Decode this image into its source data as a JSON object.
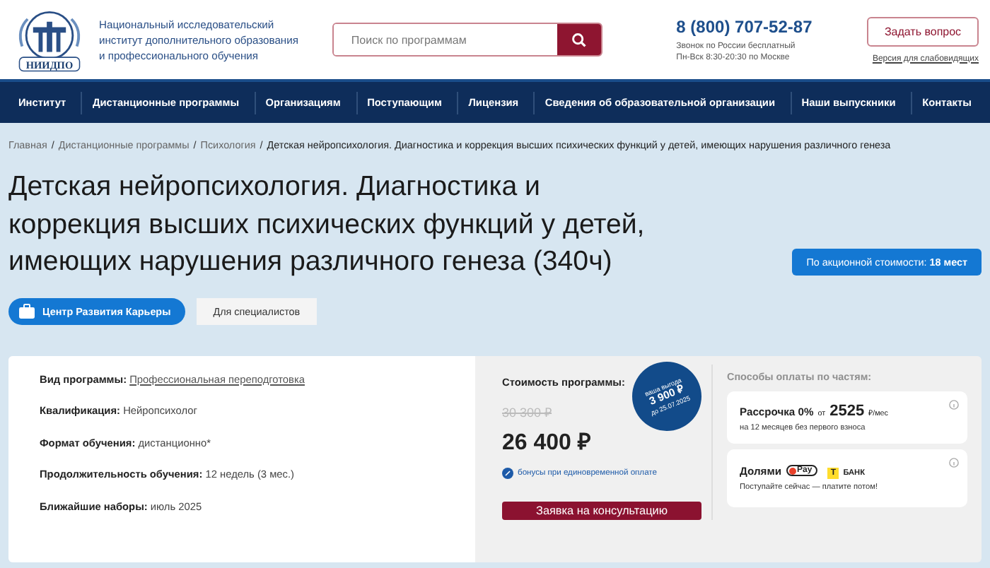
{
  "header": {
    "logo_text": "НИИДПО",
    "org_name": [
      "Национальный исследовательский",
      "институт дополнительного образования",
      "и профессионального обучения"
    ],
    "search": {
      "placeholder": "Поиск по программам"
    },
    "phone": "8 (800) 707-52-87",
    "phone_notes": [
      "Звонок по России бесплатный",
      "Пн-Вск 8:30-20:30 по Москве"
    ],
    "ask_button": "Задать вопрос",
    "accessibility_link": "Версия для слабовидящих"
  },
  "nav": [
    "Институт",
    "Дистанционные программы",
    "Организациям",
    "Поступающим",
    "Лицензия",
    "Сведения об образовательной организации",
    "Наши выпускники",
    "Контакты"
  ],
  "breadcrumb_separator": "/",
  "breadcrumbs": [
    {
      "label": "Главная",
      "kind": "link"
    },
    {
      "label": "Дистанционные программы",
      "kind": "link"
    },
    {
      "label": "Психология",
      "kind": "link"
    },
    {
      "label": "Детская нейропсихология. Диагностика и коррекция высших психических функций у детей, имеющих нарушения различного генеза",
      "kind": "current"
    }
  ],
  "title": "Детская нейропсихология. Диагностика и коррекция высших психических функций у детей, имеющих нарушения различного генеза (340ч)",
  "promo_badge": {
    "label": "По акционной стоимости:",
    "count": "18 мест"
  },
  "tags": [
    {
      "label": "Центр Развития Карьеры",
      "kind": "career"
    },
    {
      "label": "Для специалистов",
      "kind": "plain"
    }
  ],
  "details": [
    {
      "label": "Вид программы:",
      "value": "Профессиональная переподготовка",
      "kind": "link"
    },
    {
      "label": "Квалификация:",
      "value": "Нейропсихолог",
      "kind": "text"
    },
    {
      "label": "Формат обучения:",
      "value": "дистанционно*",
      "kind": "text"
    },
    {
      "label": "Продолжительность обучения:",
      "value": "12 недель (3 мес.)",
      "kind": "text"
    },
    {
      "label": "Ближайшие наборы:",
      "value": "июль 2025",
      "kind": "text"
    }
  ],
  "price": {
    "heading": "Стоимость программы:",
    "old_price": "30 300 ₽",
    "price": "26 400 ₽",
    "bonus_note": "бонусы при единовременной оплате",
    "discount": {
      "caption": "ваша выгода",
      "amount": "3 900 ₽",
      "until": "до 25.07.2025"
    },
    "button": "Заявка на консультацию"
  },
  "payment": {
    "heading": "Способы оплаты по частям:",
    "options": [
      {
        "kind": "installment",
        "title": "Рассрочка 0%",
        "prefix": "от",
        "amount": "2525",
        "unit": "₽/мес",
        "note": "на 12 месяцев без первого взноса"
      },
      {
        "kind": "split",
        "title": "Долями",
        "pay_logo": "Pay",
        "bank_mark": "T",
        "bank_logo": "БАНК",
        "note": "Поступайте сейчас — платите потом!"
      }
    ]
  }
}
